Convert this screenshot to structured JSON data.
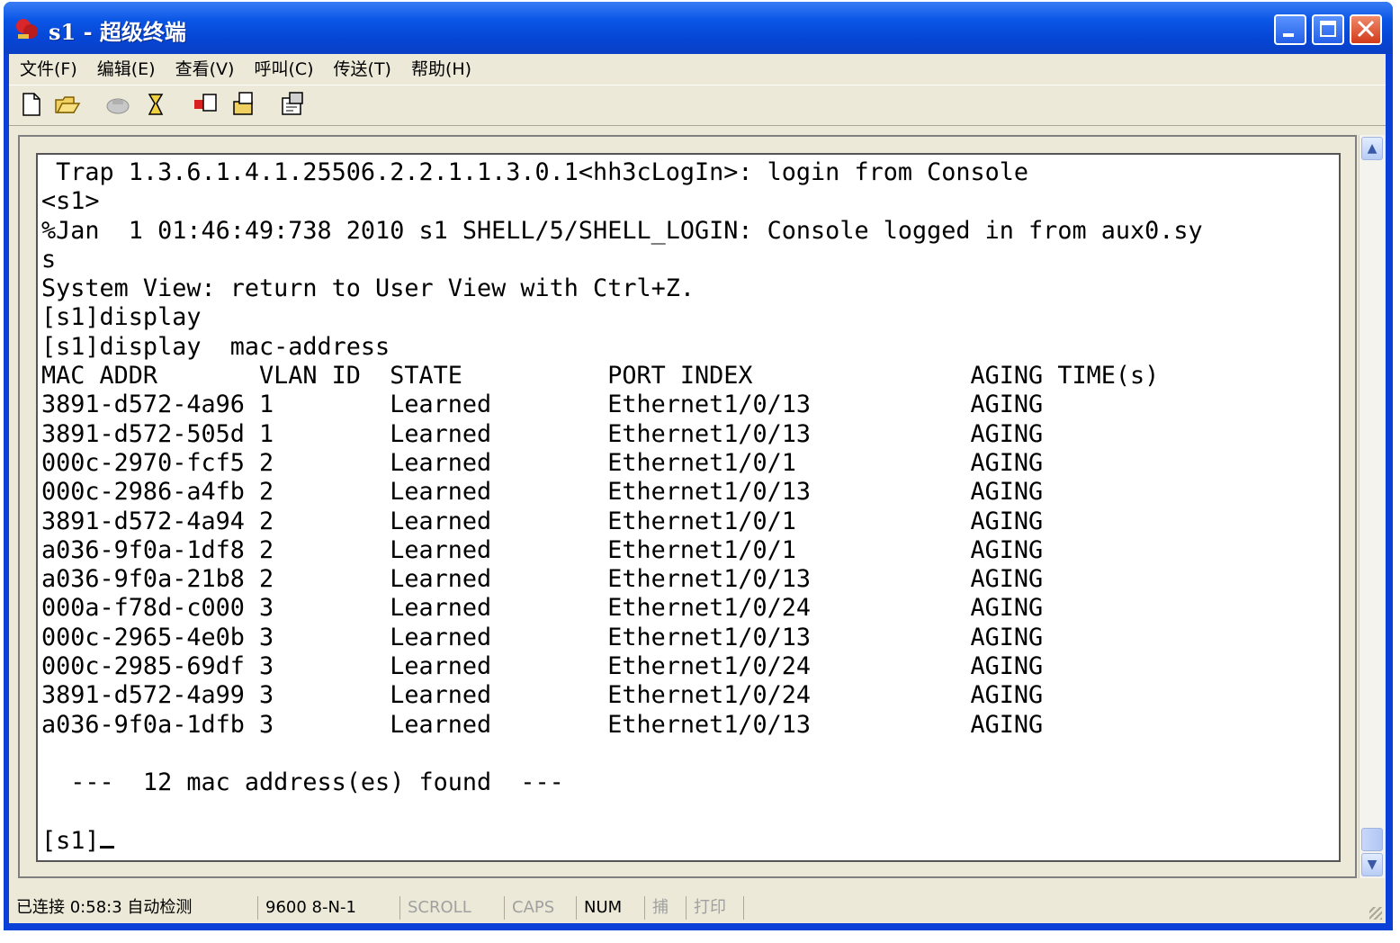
{
  "window": {
    "title": "s1 - 超级终端",
    "buttons": [
      "minimize",
      "maximize",
      "close"
    ]
  },
  "menu": {
    "items": [
      "文件(F)",
      "编辑(E)",
      "查看(V)",
      "呼叫(C)",
      "传送(T)",
      "帮助(H)"
    ]
  },
  "toolbar": {
    "icons": [
      "new-icon",
      "open-icon",
      "call-icon",
      "disconnect-icon",
      "send-icon",
      "receive-icon",
      "properties-icon"
    ]
  },
  "terminal": {
    "lines": [
      " Trap 1.3.6.1.4.1.25506.2.2.1.1.3.0.1<hh3cLogIn>: login from Console",
      "<s1>",
      "%Jan  1 01:46:49:738 2010 s1 SHELL/5/SHELL_LOGIN: Console logged in from aux0.sy",
      "s",
      "System View: return to User View with Ctrl+Z.",
      "[s1]display",
      "[s1]display  mac-address"
    ],
    "mac_table": {
      "headers": [
        "MAC ADDR",
        "VLAN ID",
        "STATE",
        "PORT INDEX",
        "AGING TIME(s)"
      ],
      "rows": [
        [
          "3891-d572-4a96",
          "1",
          "Learned",
          "Ethernet1/0/13",
          "AGING"
        ],
        [
          "3891-d572-505d",
          "1",
          "Learned",
          "Ethernet1/0/13",
          "AGING"
        ],
        [
          "000c-2970-fcf5",
          "2",
          "Learned",
          "Ethernet1/0/1",
          "AGING"
        ],
        [
          "000c-2986-a4fb",
          "2",
          "Learned",
          "Ethernet1/0/13",
          "AGING"
        ],
        [
          "3891-d572-4a94",
          "2",
          "Learned",
          "Ethernet1/0/1",
          "AGING"
        ],
        [
          "a036-9f0a-1df8",
          "2",
          "Learned",
          "Ethernet1/0/1",
          "AGING"
        ],
        [
          "a036-9f0a-21b8",
          "2",
          "Learned",
          "Ethernet1/0/13",
          "AGING"
        ],
        [
          "000a-f78d-c000",
          "3",
          "Learned",
          "Ethernet1/0/24",
          "AGING"
        ],
        [
          "000c-2965-4e0b",
          "3",
          "Learned",
          "Ethernet1/0/13",
          "AGING"
        ],
        [
          "000c-2985-69df",
          "3",
          "Learned",
          "Ethernet1/0/24",
          "AGING"
        ],
        [
          "3891-d572-4a99",
          "3",
          "Learned",
          "Ethernet1/0/24",
          "AGING"
        ],
        [
          "a036-9f0a-1dfb",
          "3",
          "Learned",
          "Ethernet1/0/13",
          "AGING"
        ]
      ]
    },
    "summary": "  ---  12 mac address(es) found  ---",
    "prompt": "[s1]"
  },
  "status": {
    "connected": "已连接 0:58:3",
    "detect": "自动检测",
    "settings": "9600 8-N-1",
    "scroll": "SCROLL",
    "caps": "CAPS",
    "num": "NUM",
    "capture": "捕",
    "print": "打印"
  }
}
